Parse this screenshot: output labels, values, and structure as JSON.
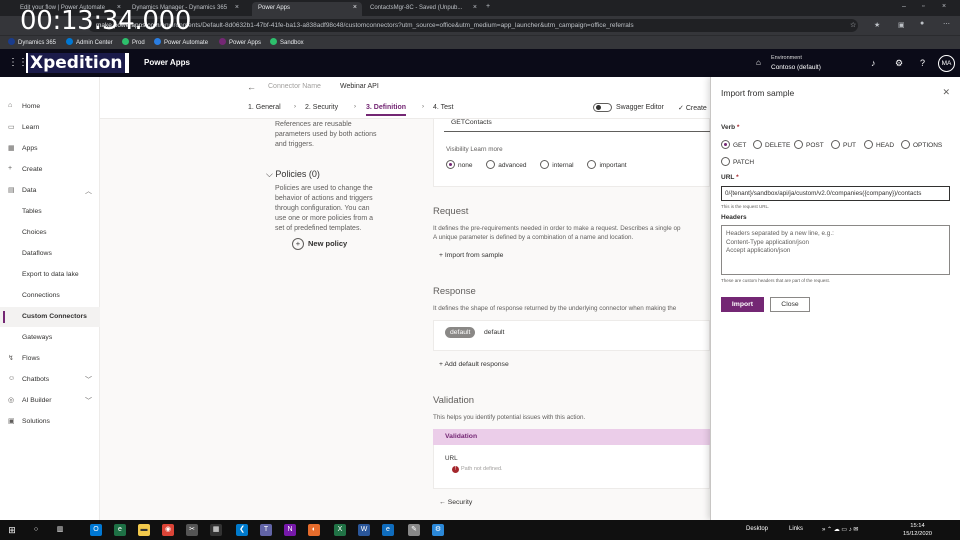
{
  "timer": "00:13:34.000",
  "browser": {
    "tabs": [
      {
        "title": "Edit your flow | Power Automate"
      },
      {
        "title": "Dynamics Manager - Dynamics 365"
      },
      {
        "title": "Power Apps"
      },
      {
        "title": "ContactsMgr-8C - Saved (Unpub..."
      }
    ],
    "url_prefix": "make.powerapps.com",
    "url": "/environments/Default-8d0632b1-47bf-41fe-ba13-a838adf98c48/customconnectors?utm_source=office&utm_medium=app_launcher&utm_campaign=office_referrals",
    "bookmarks": [
      "Dynamics 365",
      "Admin Center",
      "Prod",
      "Power Automate",
      "Power Apps",
      "Sandbox"
    ]
  },
  "header": {
    "logo": "Xpedition",
    "app_name": "Power Apps",
    "env_label": "Environment",
    "env_name": "Contoso (default)",
    "avatar": "MA"
  },
  "nav": [
    {
      "label": "Home",
      "icon": "⌂"
    },
    {
      "label": "Learn",
      "icon": "▭"
    },
    {
      "label": "Apps",
      "icon": "▦"
    },
    {
      "label": "Create",
      "icon": "+"
    },
    {
      "label": "Data",
      "icon": "▤"
    },
    {
      "label": "Tables"
    },
    {
      "label": "Choices"
    },
    {
      "label": "Dataflows"
    },
    {
      "label": "Export to data lake"
    },
    {
      "label": "Connections"
    },
    {
      "label": "Custom Connectors"
    },
    {
      "label": "Gateways"
    },
    {
      "label": "Flows",
      "icon": "↯"
    },
    {
      "label": "Chatbots",
      "icon": "☺"
    },
    {
      "label": "AI Builder",
      "icon": "◎"
    },
    {
      "label": "Solutions",
      "icon": "▣"
    }
  ],
  "cmdbar": {
    "connector_name_label": "Connector Name",
    "connector_name_value": "Webinar API",
    "steps": [
      "1. General",
      "2. Security",
      "3. Definition",
      "4. Test"
    ],
    "swagger_label": "Swagger Editor",
    "create_label": "Create"
  },
  "left_col": {
    "policies_text1": "References are reusable",
    "policies_text2": "parameters used by both actions",
    "policies_text3": "and triggers.",
    "policies_title": "Policies (0)",
    "policies_desc1": "Policies are used to change the",
    "policies_desc2": "behavior of actions and triggers",
    "policies_desc3": "through configuration. You can",
    "policies_desc4": "use one or more policies from a",
    "policies_desc5": "set of predefined templates.",
    "new_policy": "New policy"
  },
  "main": {
    "operation_id": "GETContacts",
    "visibility_label": "Visibility Learn more",
    "visibility_options": [
      "none",
      "advanced",
      "internal",
      "important"
    ],
    "request_title": "Request",
    "request_desc1": "It defines the pre-requirements needed in order to make a request. Describes a single op",
    "request_desc2": "A unique parameter is defined by a combination of a name and location.",
    "import_sample": "Import from sample",
    "response_title": "Response",
    "response_desc": "It defines the shape of response returned by the underlying connector when making the",
    "response_tag": "default",
    "response_tag_text": "default",
    "add_default_response": "Add default response",
    "validation_title": "Validation",
    "validation_desc": "This helps you identify potential issues with this action.",
    "validation_header": "Validation",
    "url_label": "URL",
    "url_error": "Path not defined.",
    "security_back": "Security"
  },
  "panel": {
    "title": "Import from sample",
    "verb_label": "Verb",
    "verbs": [
      "GET",
      "DELETE",
      "POST",
      "PUT",
      "HEAD",
      "OPTIONS",
      "PATCH"
    ],
    "url_label": "URL",
    "url_value": "0/{tenant}/sandbox/api/ja/custom/v2.0/companies({company})/contacts",
    "url_hint": "This is the request URL.",
    "headers_label": "Headers",
    "headers_placeholder_1": "Headers separated by a new line, e.g.:",
    "headers_placeholder_2": "Content-Type application/json",
    "headers_placeholder_3": "Accept application/json",
    "headers_hint": "These are custom headers that are part of the request.",
    "import_btn": "Import",
    "close_btn": "Close"
  },
  "taskbar": {
    "desktop": "Desktop",
    "links": "Links",
    "time": "15:14",
    "date": "15/12/2020"
  },
  "colors": {
    "accent": "#742774",
    "header_bg": "#0b0b18",
    "validation_bg": "#ebcde9"
  }
}
